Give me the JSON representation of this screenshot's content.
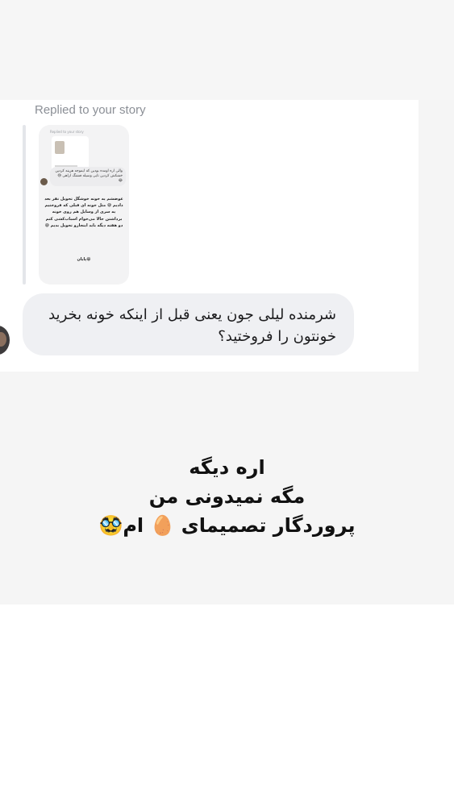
{
  "story_reply": {
    "label": "Replied to your story",
    "thumbnail": {
      "replied_label": "Replied to your story",
      "reply_text": "والی اره اومده بودین که ایموجه هزینه کردین خشکش کردین تایی وسیله فشنگ اراهی 😅😂",
      "story_text": "عوضشم یه خونه خوشگل تحویل نفر بعد دادیم 😅 مثل خونه ای قبلی که فروختیم یه سری از وسایل هم روی خونه برداشتن حالا می‌خوام اسباب‌کشی کنم دو هفته دیگه باید اینجارو تحویل بدیم 😅",
      "end_text": "پایان😁"
    }
  },
  "message": {
    "text": "شرمنده لیلی جون یعنی قبل از اینکه خونه بخرید خونتون را فروختید؟"
  },
  "overlay": {
    "line1": "اره دیگه",
    "line2": "مگه نمیدونی من",
    "line3": "پروردگار تصمیمای 🥚 ام🥸"
  }
}
